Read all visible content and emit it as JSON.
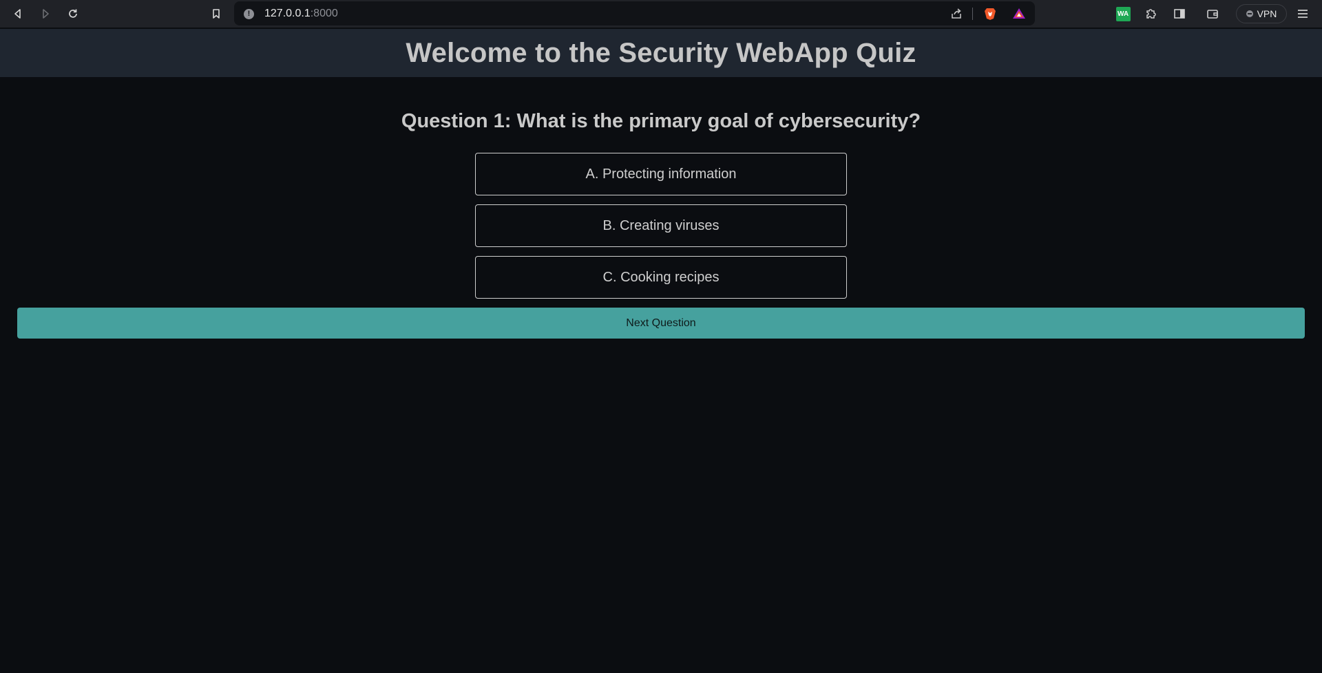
{
  "browser": {
    "url_host": "127.0.0.1",
    "url_port": ":8000",
    "vpn_label": "VPN",
    "extension_badge": "WA",
    "icons": [
      "back-icon",
      "forward-icon",
      "reload-icon",
      "bookmark-icon",
      "site-info-icon",
      "share-icon",
      "brave-shield-icon",
      "brave-rewards-icon",
      "extensions-icon",
      "sidebar-icon",
      "wallet-icon",
      "menu-icon"
    ]
  },
  "header": {
    "title": "Welcome to the Security WebApp Quiz"
  },
  "quiz": {
    "question": "Question 1: What is the primary goal of cybersecurity?",
    "options": [
      "A. Protecting information",
      "B. Creating viruses",
      "C. Cooking recipes"
    ],
    "next_label": "Next Question"
  },
  "colors": {
    "page_bg": "#0b0d11",
    "header_bg": "#1f2630",
    "accent": "#46a19e",
    "text": "#c6c6c6"
  }
}
